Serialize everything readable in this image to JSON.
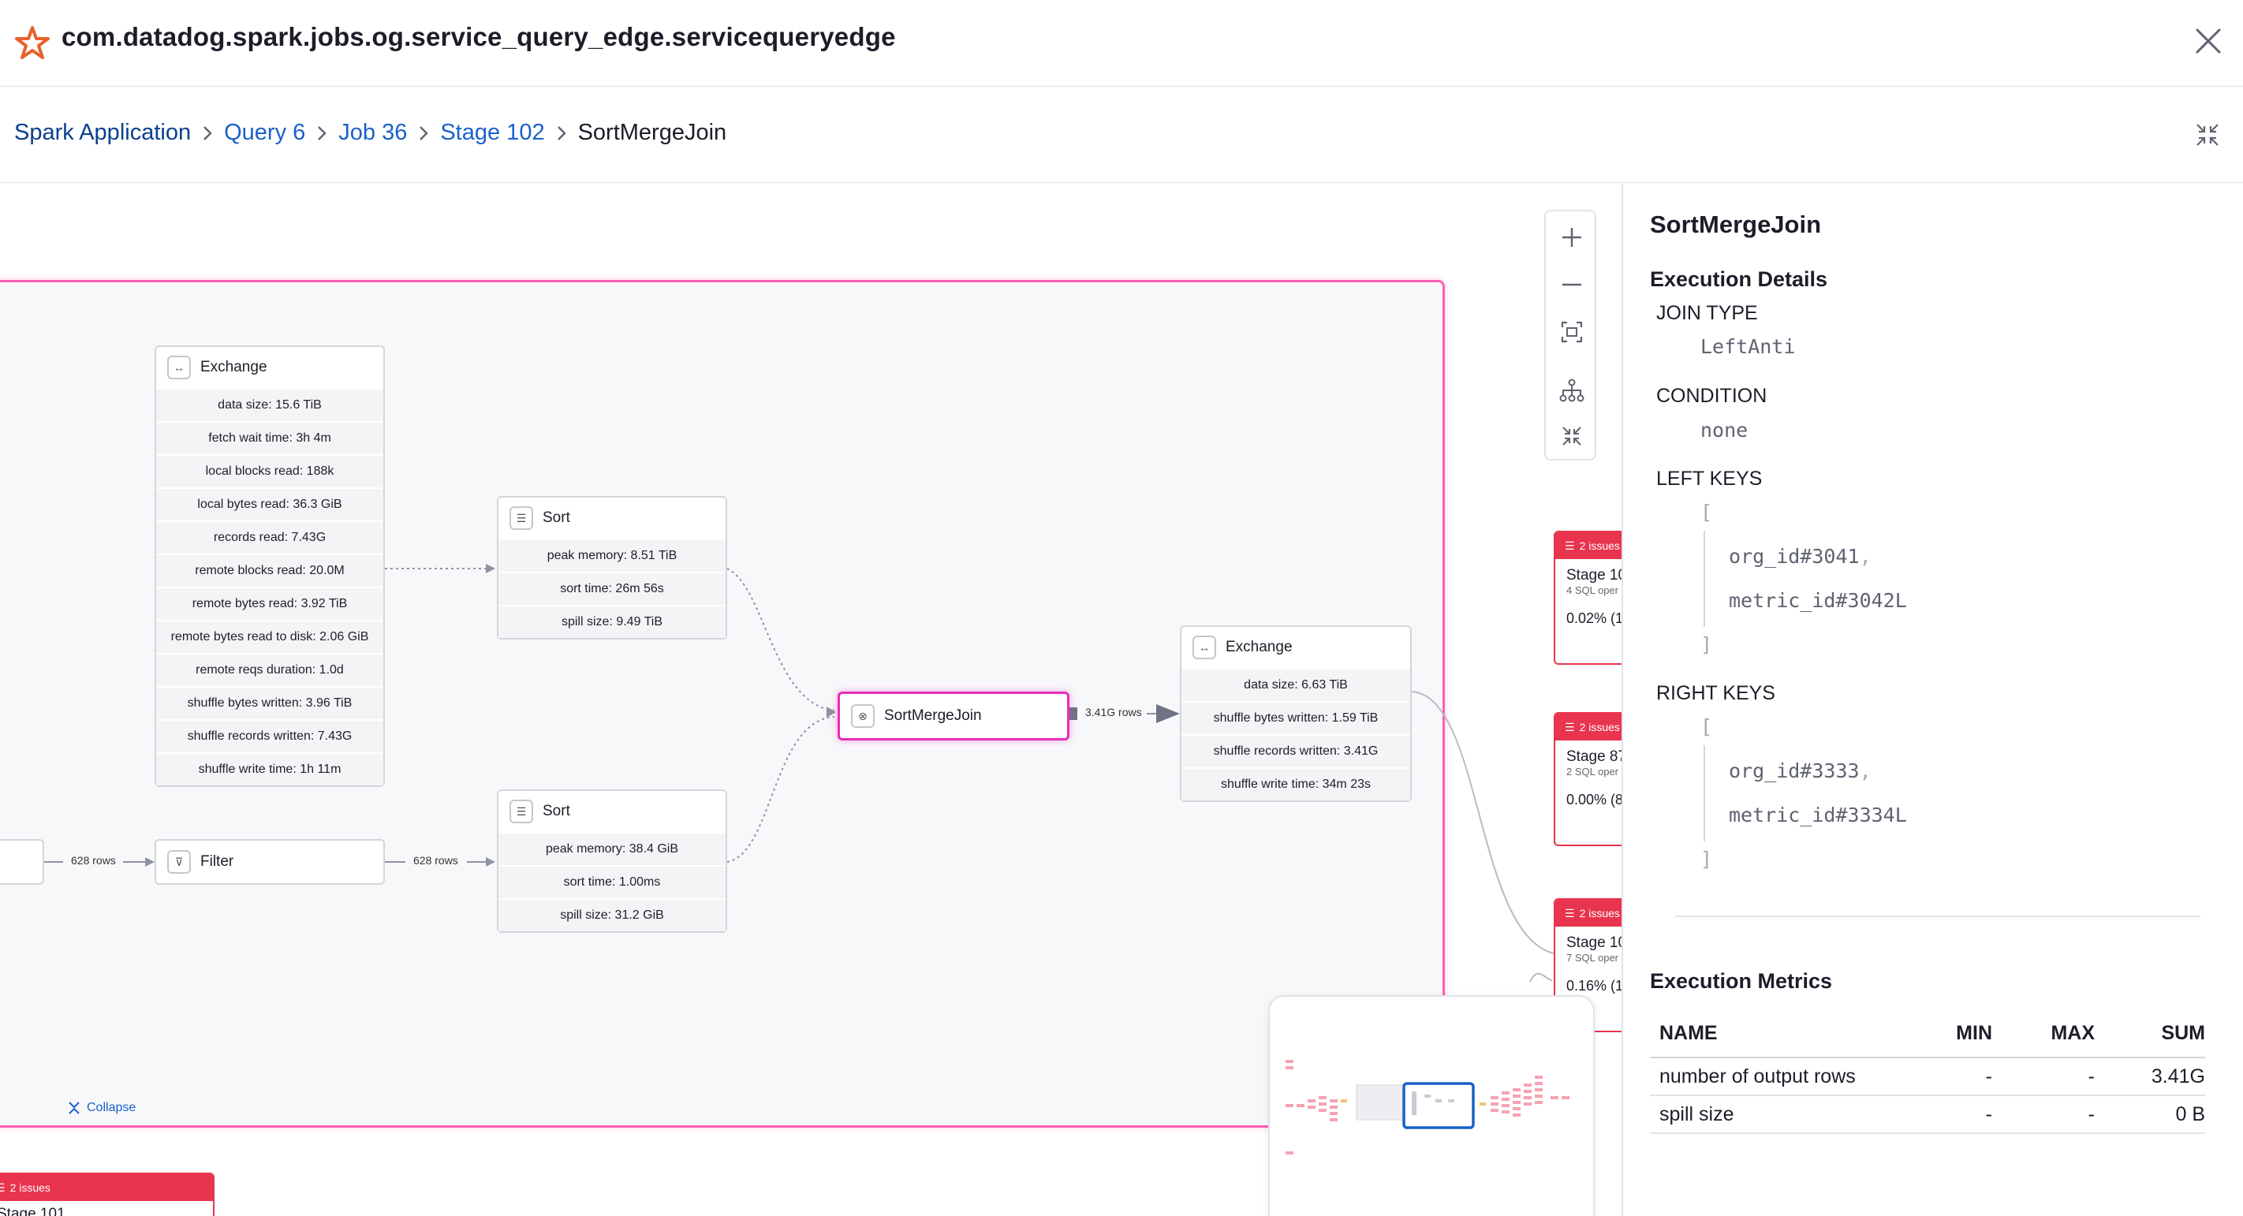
{
  "header": {
    "title": "com.datadog.spark.jobs.og.service_query_edge.servicequeryedge"
  },
  "breadcrumb": {
    "items": [
      "Spark Application",
      "Query 6",
      "Job 36",
      "Stage 102"
    ],
    "current": "SortMergeJoin"
  },
  "graph": {
    "exchange_left": {
      "title": "Exchange",
      "metrics": [
        "data size: 15.6 TiB",
        "fetch wait time: 3h 4m",
        "local blocks read: 188k",
        "local bytes read: 36.3 GiB",
        "records read: 7.43G",
        "remote blocks read: 20.0M",
        "remote bytes read: 3.92 TiB",
        "remote bytes read to disk: 2.06 GiB",
        "remote reqs duration: 1.0d",
        "shuffle bytes written: 3.96 TiB",
        "shuffle records written: 7.43G",
        "shuffle write time: 1h 11m"
      ]
    },
    "sort_top": {
      "title": "Sort",
      "metrics": [
        "peak memory: 8.51 TiB",
        "sort time: 26m 56s",
        "spill size: 9.49 TiB"
      ]
    },
    "sort_bottom": {
      "title": "Sort",
      "metrics": [
        "peak memory: 38.4 GiB",
        "sort time: 1.00ms",
        "spill size: 31.2 GiB"
      ]
    },
    "filter": {
      "title": "Filter"
    },
    "smj": {
      "title": "SortMergeJoin"
    },
    "exchange_right": {
      "title": "Exchange",
      "metrics": [
        "data size: 6.63 TiB",
        "shuffle bytes written: 1.59 TiB",
        "shuffle records written: 3.41G",
        "shuffle write time: 34m 23s"
      ]
    },
    "edge_labels": {
      "in_filter": "628 rows",
      "filter_sort": "628 rows",
      "smj_exchange": "3.41G rows"
    },
    "collapse_label": "Collapse",
    "stage_cards": [
      {
        "issues": "2 issues",
        "name": "Stage 10",
        "sub": "4 SQL oper",
        "pct": "0.02% (1"
      },
      {
        "issues": "2 issues",
        "name": "Stage 87",
        "sub": "2 SQL oper",
        "pct": "0.00% (8"
      },
      {
        "issues": "2 issues",
        "name": "Stage 10",
        "sub": "7 SQL oper",
        "pct": "0.16% (1"
      }
    ],
    "bottom_card": {
      "issues": "2 issues",
      "name": "Stage 101"
    }
  },
  "details": {
    "title": "SortMergeJoin",
    "execution_details_label": "Execution Details",
    "join_type_label": "JOIN TYPE",
    "join_type": "LeftAnti",
    "condition_label": "CONDITION",
    "condition": "none",
    "left_keys_label": "LEFT KEYS",
    "left_keys": [
      "org_id#3041",
      "metric_id#3042L"
    ],
    "right_keys_label": "RIGHT KEYS",
    "right_keys": [
      "org_id#3333",
      "metric_id#3334L"
    ],
    "open_bracket": "[",
    "close_bracket": "]",
    "comma": ",",
    "execution_metrics_label": "Execution Metrics",
    "table": {
      "columns": [
        "NAME",
        "MIN",
        "MAX",
        "SUM"
      ],
      "rows": [
        [
          "number of output rows",
          "-",
          "-",
          "3.41G"
        ],
        [
          "spill size",
          "-",
          "-",
          "0 B"
        ]
      ]
    }
  },
  "colors": {
    "accent_pink": "#e62eb8",
    "issue_red": "#e8344e",
    "link_blue": "#1961c9",
    "brand_orange": "#e8612c"
  }
}
